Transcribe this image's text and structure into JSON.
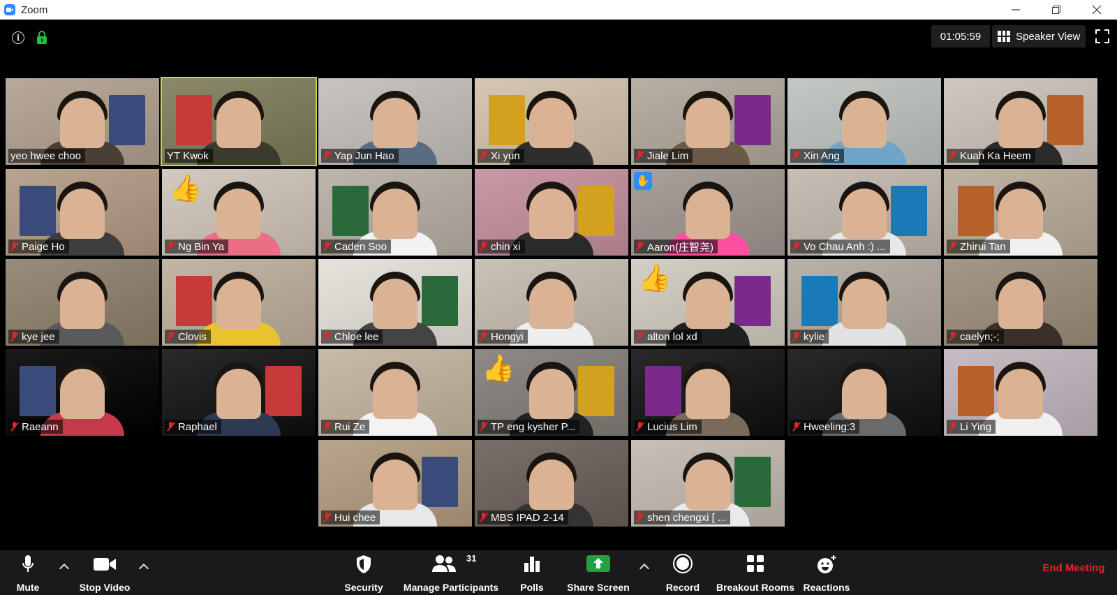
{
  "window": {
    "title": "Zoom",
    "controls": [
      "minimize",
      "restore",
      "close"
    ]
  },
  "meeting_top": {
    "timer": "01:05:59",
    "view_mode": "Speaker View"
  },
  "participants": [
    {
      "name": "yeo hwee choo",
      "muted": false,
      "active": false
    },
    {
      "name": "YT Kwok",
      "muted": false,
      "active": true
    },
    {
      "name": "Yap Jun Hao",
      "muted": true,
      "active": false
    },
    {
      "name": "Xi yun",
      "muted": true,
      "active": false
    },
    {
      "name": "Jiale Lim",
      "muted": true,
      "active": false
    },
    {
      "name": "Xin Ang",
      "muted": true,
      "active": false
    },
    {
      "name": "Kuah Ka Heem",
      "muted": true,
      "active": false
    },
    {
      "name": "Paige Ho",
      "muted": true,
      "active": false
    },
    {
      "name": "Ng Bin Ya",
      "muted": true,
      "active": false,
      "reaction": "thumbs-up"
    },
    {
      "name": "Caden Soo",
      "muted": true,
      "active": false
    },
    {
      "name": "chin xi",
      "muted": true,
      "active": false
    },
    {
      "name": "Aaron(庄智尧)",
      "muted": true,
      "active": false,
      "raised_hand": true
    },
    {
      "name": "Vo Chau Anh :) ...",
      "muted": true,
      "active": false
    },
    {
      "name": "Zhirui Tan",
      "muted": true,
      "active": false
    },
    {
      "name": "kye jee",
      "muted": true,
      "active": false
    },
    {
      "name": "Clovis",
      "muted": true,
      "active": false
    },
    {
      "name": "Chloe lee",
      "muted": true,
      "active": false
    },
    {
      "name": "Hongyi",
      "muted": true,
      "active": false
    },
    {
      "name": "alton lol xd",
      "muted": true,
      "active": false,
      "reaction": "thumbs-up"
    },
    {
      "name": "kylie",
      "muted": true,
      "active": false
    },
    {
      "name": "caelyn;-;",
      "muted": true,
      "active": false
    },
    {
      "name": "Raeann",
      "muted": true,
      "active": false
    },
    {
      "name": "Raphael",
      "muted": true,
      "active": false
    },
    {
      "name": "Rui Ze",
      "muted": true,
      "active": false
    },
    {
      "name": "TP eng kysher P...",
      "muted": true,
      "active": false,
      "reaction": "thumbs-up"
    },
    {
      "name": "Lucius Lim",
      "muted": true,
      "active": false
    },
    {
      "name": "Hweeling:3",
      "muted": true,
      "active": false
    },
    {
      "name": "Li Ying",
      "muted": true,
      "active": false
    },
    {
      "name": "Hui chee",
      "muted": true,
      "active": false
    },
    {
      "name": "MBS IPAD 2-14",
      "muted": true,
      "active": false
    },
    {
      "name": "shen chengxi [ ...",
      "muted": true,
      "active": false
    }
  ],
  "toolbar": {
    "mute": "Mute",
    "stop_video": "Stop Video",
    "security": "Security",
    "manage_participants": "Manage Participants",
    "participant_count": "31",
    "polls": "Polls",
    "share_screen": "Share Screen",
    "record": "Record",
    "breakout_rooms": "Breakout Rooms",
    "reactions": "Reactions",
    "end_meeting": "End Meeting"
  },
  "colors": {
    "active_speaker_border": "#c9d64a",
    "muted_red": "#e02828",
    "share_green": "#23a041",
    "end_red": "#e02828",
    "toolbar_bg": "#1a1a1a"
  }
}
